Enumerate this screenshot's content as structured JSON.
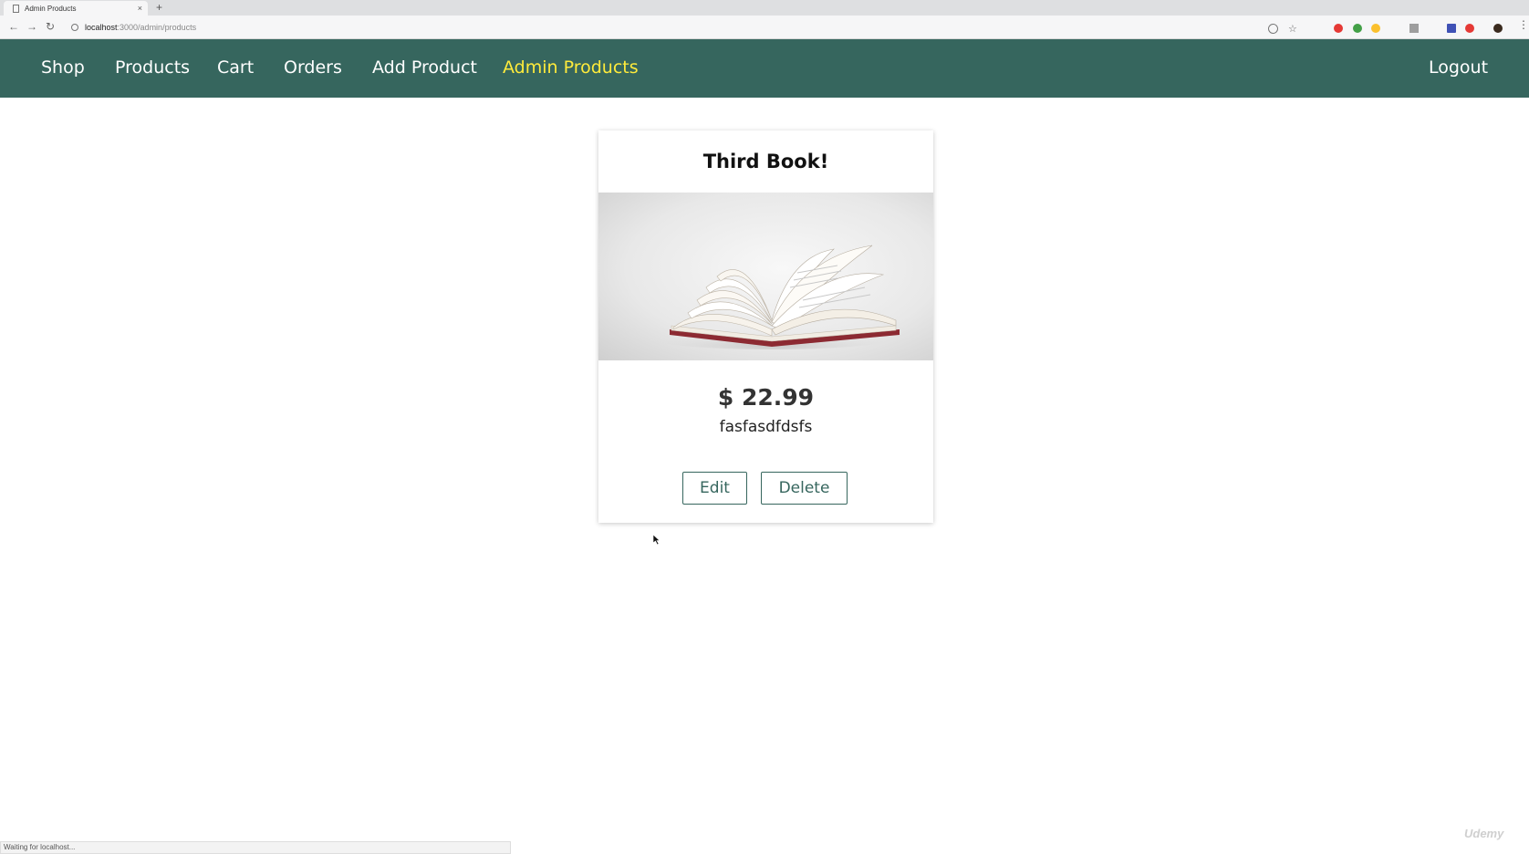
{
  "browser": {
    "tab_title": "Admin Products",
    "tab_close": "×",
    "new_tab": "+",
    "back": "←",
    "forward": "→",
    "reload": "↻",
    "url_host": "localhost",
    "url_path": ":3000/admin/products",
    "menu": "⋮",
    "status_text": "Waiting for localhost..."
  },
  "nav": {
    "items": [
      {
        "label": "Shop"
      },
      {
        "label": "Products"
      },
      {
        "label": "Cart"
      },
      {
        "label": "Orders"
      },
      {
        "label": "Add Product"
      },
      {
        "label": "Admin Products",
        "active": true
      }
    ],
    "logout_label": "Logout",
    "bg_color": "#36665e",
    "active_color": "#ffeb3b"
  },
  "product": {
    "title": "Third Book!",
    "image_icon": "open-book-image",
    "price": "$ 22.99",
    "description": "fasfasdfdsfs",
    "edit_label": "Edit",
    "delete_label": "Delete"
  },
  "watermark": "Udemy"
}
